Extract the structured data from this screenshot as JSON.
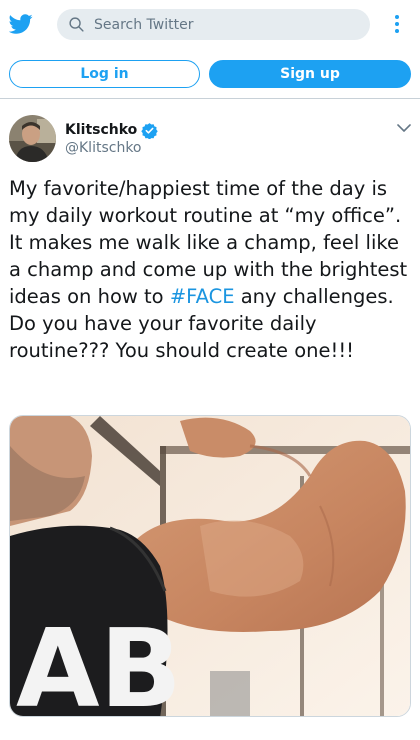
{
  "header": {
    "logo_icon": "twitter-bird-icon",
    "search": {
      "placeholder": "Search Twitter",
      "value": ""
    },
    "more_icon": "more-vertical-icon"
  },
  "auth": {
    "login_label": "Log in",
    "signup_label": "Sign up"
  },
  "tweet": {
    "author": {
      "name": "Klitschko",
      "handle": "@Klitschko",
      "verified": true
    },
    "text_before": "My favorite/happiest time of the day is my daily workout routine at “my office”. It makes me walk like a champ, feel like a champ and come up with the brightest ideas on how to ",
    "hashtag": "#FACE",
    "text_after": " any challenges. Do you have your favorite daily routine??? You should create one!!!",
    "media": {
      "shirt_text": "AB"
    },
    "menu_icon": "chevron-down-icon"
  },
  "colors": {
    "brand": "#1da1f2",
    "hashtag": "#1b95e0",
    "text": "#14171a",
    "muted": "#657786"
  }
}
